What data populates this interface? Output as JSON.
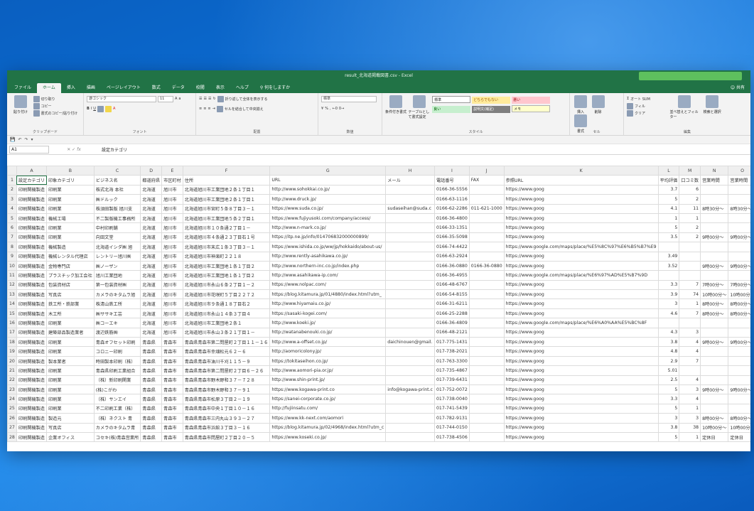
{
  "window": {
    "title": "result_北海道掲載図書.csv - Excel",
    "tabs": [
      "ファイル",
      "ホーム",
      "挿入",
      "描画",
      "ページレイアウト",
      "数式",
      "データ",
      "校閲",
      "表示",
      "ヘルプ"
    ],
    "active_tab": "ホーム",
    "search_label": "何をしますか",
    "user": "共有"
  },
  "ribbon": {
    "clipboard": {
      "paste": "貼り付け",
      "cut": "切り取り",
      "copy": "コピー",
      "format_painter": "書式のコピー/貼り付け",
      "label": "クリップボード"
    },
    "font": {
      "name": "游ゴシック",
      "size": "11",
      "label": "フォント"
    },
    "alignment": {
      "wrap": "折り返して全体を表示する",
      "merge": "セルを結合して中央揃え",
      "label": "配置"
    },
    "number": {
      "format": "標準",
      "label": "数値"
    },
    "styles": {
      "conditional": "条件付き書式",
      "table": "テーブルとして書式設定",
      "cells": [
        "標準",
        "どちらでもない",
        "悪い",
        "良い",
        "説明文(補足)",
        "メモ"
      ],
      "label": "スタイル"
    },
    "cells_group": {
      "insert": "挿入",
      "delete": "削除",
      "format": "書式",
      "label": "セル"
    },
    "editing": {
      "autosum": "オート SUM",
      "fill": "フィル",
      "clear": "クリア",
      "sort": "並べ替えとフィルター",
      "find": "検索と選択",
      "label": "編集"
    }
  },
  "formula_bar": {
    "name_box": "A1",
    "value": "設定カテゴリ"
  },
  "columns": [
    "A",
    "B",
    "C",
    "D",
    "E",
    "F",
    "G",
    "H",
    "I",
    "J",
    "K",
    "L",
    "M",
    "N",
    "O",
    "P"
  ],
  "rows": [
    [
      "設定カテゴリ",
      "印象カテゴリ",
      "ビジネス名",
      "都道府県",
      "市区町村",
      "住所",
      "URL",
      "メール",
      "電話番号",
      "FAX",
      "参照URL",
      "平均評価",
      "口コミ数",
      "営業時間",
      "営業時間",
      "営業"
    ],
    [
      "印刷関機製造",
      "印刷業",
      "株式北海 本社",
      "北海道",
      "旭川市",
      "北海道旭川市工業団地２条１丁目１",
      "http://www.sohokkai.co.jp/",
      "",
      "0166-36-5556",
      "",
      "https://www.goog",
      "3.7",
      "6",
      "",
      "",
      ""
    ],
    [
      "印刷関機製造",
      "印刷業",
      "㈱ドルック",
      "北海道",
      "旭川市",
      "北海道旭川市工業団地２条１丁目１",
      "http://www.druck.jp/",
      "",
      "0166-63-1116",
      "",
      "https://www.goog",
      "5",
      "2",
      "",
      "",
      ""
    ],
    [
      "印刷関機製造",
      "印刷業",
      "株須田製版 旭川支",
      "北海道",
      "旭川市",
      "北海道旭川市宮町５条８丁目３－１",
      "https://www.suda.co.jp/",
      "sudaseihan@suda.c",
      "0166-62-2286",
      "011-621-1000",
      "https://www.goog",
      "4.1",
      "11",
      "8時30分～",
      "8時30分～",
      "8時3"
    ],
    [
      "印刷関機製造",
      "機械工場",
      "不二製版機工事務所",
      "北海道",
      "旭川市",
      "北海道旭川市工業団地５条２丁目１",
      "https://www.fujiyusoki.com/company/access/",
      "",
      "0166-36-4800",
      "",
      "https://www.goog",
      "1",
      "1",
      "",
      "",
      ""
    ],
    [
      "印刷関機製造",
      "印刷業",
      "中村印刷舗",
      "北海道",
      "旭川市",
      "北海道旭川市１０条通２丁目１－",
      "http://www.n-mark.co.jp/",
      "",
      "0166-33-1351",
      "",
      "https://www.goog",
      "5",
      "2",
      "",
      "",
      ""
    ],
    [
      "印刷関機製造",
      "印刷業",
      "向田文堂",
      "北海道",
      "旭川市",
      "北海道旭川市４条通２３丁目右１号",
      "https://itp.ne.jp/info/014706832000000899/",
      "",
      "0166-35-5098",
      "",
      "https://www.goog",
      "3.5",
      "2",
      "9時00分～",
      "9時00分～",
      "9時0"
    ],
    [
      "印刷関機製造",
      "機械製造",
      "北海道イシダ㈱ 旭",
      "北海道",
      "旭川市",
      "北海道旭川市末広１条３丁目３－１",
      "https://www.ishida.co.jp/ww/jp/hokkaido/about-us/",
      "",
      "0166-74-4422",
      "",
      "https://www.google.com/maps/place/%E5%8C%97%E6%B5%B7%E9",
      "",
      "",
      "",
      "",
      ""
    ],
    [
      "印刷関機製造",
      "機械レンタル代理店",
      "レントリー旭川㈱",
      "北海道",
      "旭川市",
      "北海道旭川市神楽町２２１８",
      "http://www.rently-asahikawa.co.jp/",
      "",
      "0166-63-2924",
      "",
      "https://www.goog",
      "3.49",
      "",
      "",
      "",
      ""
    ],
    [
      "印刷関機製造",
      "金物専門店",
      "㈱ノーザン",
      "北海道",
      "旭川市",
      "北海道旭川市工業団地１条１丁目２",
      "http://www.northern-inc.co.jp/index.php",
      "",
      "0166-36-0880",
      "0166-36-0880",
      "https://www.goog",
      "3.52",
      "",
      "9時00分～",
      "9時00分～",
      "9時0"
    ],
    [
      "印刷関機製造",
      "プラスチック加工会社",
      "旭川工業団地",
      "北海道",
      "旭川市",
      "北海道旭川市工業団地１条１丁目２",
      "http://www.asahikawa-ip.com/",
      "",
      "0166-36-4955",
      "",
      "https://www.google.com/maps/place/%E6%97%AD%E5%B7%9D",
      "",
      "",
      "",
      "",
      ""
    ],
    [
      "印刷関機製造",
      "包装資材店",
      "第一包装資材㈱",
      "北海道",
      "旭川市",
      "北海道旭川市永山６条２丁目１－２",
      "https://www.nolpac.com/",
      "",
      "0166-48-6767",
      "",
      "https://www.goog",
      "3.3",
      "7",
      "7時00分～",
      "7時00分～",
      "7時0"
    ],
    [
      "印刷関機製造",
      "写真店",
      "カメラのキタムラ旭",
      "北海道",
      "旭川市",
      "北海道旭川市花咲町５丁目２２７２",
      "https://blog.kitamura.jp/01/4880/index.html?utm_",
      "",
      "0166-54-8155",
      "",
      "https://www.goog",
      "3.9",
      "74",
      "10時00分～",
      "10時00分～",
      "10時"
    ],
    [
      "印刷関機製造",
      "鉄工所・鉄部業",
      "株清山鉄工所",
      "北海道",
      "旭川市",
      "北海道旭川市９条通１８丁目右２",
      "http://www.hiyamaiu.co.jp/",
      "",
      "0166-31-6211",
      "",
      "https://www.goog",
      "3",
      "1",
      "8時00分～",
      "8時00分～",
      "8時0"
    ],
    [
      "印刷関機製造",
      "木工所",
      "㈱ササキ工芸",
      "北海道",
      "旭川市",
      "北海道旭川市永山１４条３丁目４",
      "https://sasaki-kogei.com/",
      "",
      "0166-25-2288",
      "",
      "https://www.goog",
      "4.6",
      "7",
      "8時00分～",
      "8時00分～",
      "8時0"
    ],
    [
      "印刷関機製造",
      "印刷業",
      "㈱コーエキ",
      "北海道",
      "旭川市",
      "北海道旭川市工業団地２条１",
      "http://www.koeki.jp/",
      "",
      "0166-36-4809",
      "",
      "https://www.google.com/maps/place/%E6%A0%AA%E5%BC%8F",
      "",
      "",
      "",
      "",
      ""
    ],
    [
      "印刷関機製造",
      "建築部品製造業者",
      "渡辺鉄筋㈱",
      "北海道",
      "旭川市",
      "北海道旭川市永山３条２１丁目１－",
      "http://watanabenouki.co.jp/",
      "",
      "0166-48-2121",
      "",
      "https://www.goog",
      "4.3",
      "3",
      "",
      "",
      ""
    ],
    [
      "印刷関機製造",
      "印刷業",
      "青森オフセット印刷",
      "青森県",
      "青森市",
      "青森県青森市第二問屋町２丁目１１－１６",
      "http://www.a-offset.co.jp/",
      "daichinouen@gmail.",
      "017-775-1431",
      "",
      "https://www.goog",
      "3.8",
      "4",
      "9時00分～",
      "9時00分～",
      "9時0"
    ],
    [
      "印刷関機製造",
      "印刷業",
      "コロニー印刷",
      "青森県",
      "青森市",
      "青森県青森市幸畑松元６２－６",
      "http://aomoricolony.jp/",
      "",
      "017-738-2021",
      "",
      "https://www.goog",
      "4.8",
      "4",
      "",
      "",
      ""
    ],
    [
      "印刷関機製造",
      "製本業者",
      "時田製本印刷（株）",
      "青森県",
      "青森市",
      "青森県青森市油川千刈１１５－９",
      "https://tokitaseihon.co.jp/",
      "",
      "017-763-3300",
      "",
      "https://www.goog",
      "2.9",
      "7",
      "",
      "",
      ""
    ],
    [
      "印刷関機製造",
      "印刷業",
      "青森県印刷工業組合",
      "青森県",
      "青森市",
      "青森県青森市第二問屋町２丁目６－２６",
      "http://www.aomori-pia.or.jp/",
      "",
      "017-735-4867",
      "",
      "https://www.goog",
      "5.01",
      "",
      "",
      "",
      ""
    ],
    [
      "印刷関機製造",
      "印刷業",
      "（株）新印刷関業",
      "青森県",
      "青森市",
      "青森県青森市野木野和３７－７２８",
      "http://www.shin-print.jp/",
      "",
      "017-739-6431",
      "",
      "https://www.goog",
      "2.5",
      "4",
      "",
      "",
      ""
    ],
    [
      "印刷関機製造",
      "印刷業",
      "(株)こがわ",
      "青森県",
      "青森市",
      "青森県青森市野木野和３７－９１",
      "https://www.kogawa-print.co",
      "info@kogawa-print.c",
      "017-752-0072",
      "",
      "https://www.goog",
      "5",
      "3",
      "9時00分～",
      "9時00分～",
      "9時0"
    ],
    [
      "印刷関機製造",
      "印刷業",
      "（株）サンエイ",
      "青森県",
      "青森市",
      "青森県青森市松原３丁目２－１９",
      "https://sanei-corporate.co.jp/",
      "",
      "017-738-0040",
      "",
      "https://www.goog",
      "3.3",
      "4",
      "",
      "",
      ""
    ],
    [
      "印刷関機製造",
      "印刷業",
      "不二印刷工業（株）",
      "青森県",
      "青森市",
      "青森県青森市中央１丁目１０－１６",
      "http://fujiinsatu.com/",
      "",
      "017-741-5439",
      "",
      "https://www.goog",
      "5",
      "1",
      "",
      "",
      ""
    ],
    [
      "印刷関機製造",
      "製造元",
      "（株）ネクスト 青",
      "青森県",
      "青森市",
      "青森県青森市三内丸山３９３－２７",
      "https://www.kk-next.com/aomori",
      "",
      "017-782-9131",
      "",
      "https://www.goog",
      "3",
      "3",
      "8時00分～",
      "8時00分～",
      "8時0"
    ],
    [
      "印刷関機製造",
      "写真店",
      "カメラのキタムラ青",
      "青森県",
      "青森市",
      "青森県青森市浜館３丁目３－１６",
      "https://blog.kitamura.jp/02/4968/index.html?utm_c",
      "",
      "017-744-0150",
      "",
      "https://www.goog",
      "3.8",
      "38",
      "10時00分～",
      "10時00分～",
      "10時"
    ],
    [
      "印刷関機製造",
      "企業オフィス",
      "コセキ(株)青森営業所",
      "青森県",
      "青森市",
      "青森県青森市問屋町２丁目２０－５",
      "https://www.koseki.co.jp/",
      "",
      "017-738-4506",
      "",
      "https://www.goog",
      "5",
      "1",
      "定休日",
      "定休日",
      "7時"
    ]
  ]
}
